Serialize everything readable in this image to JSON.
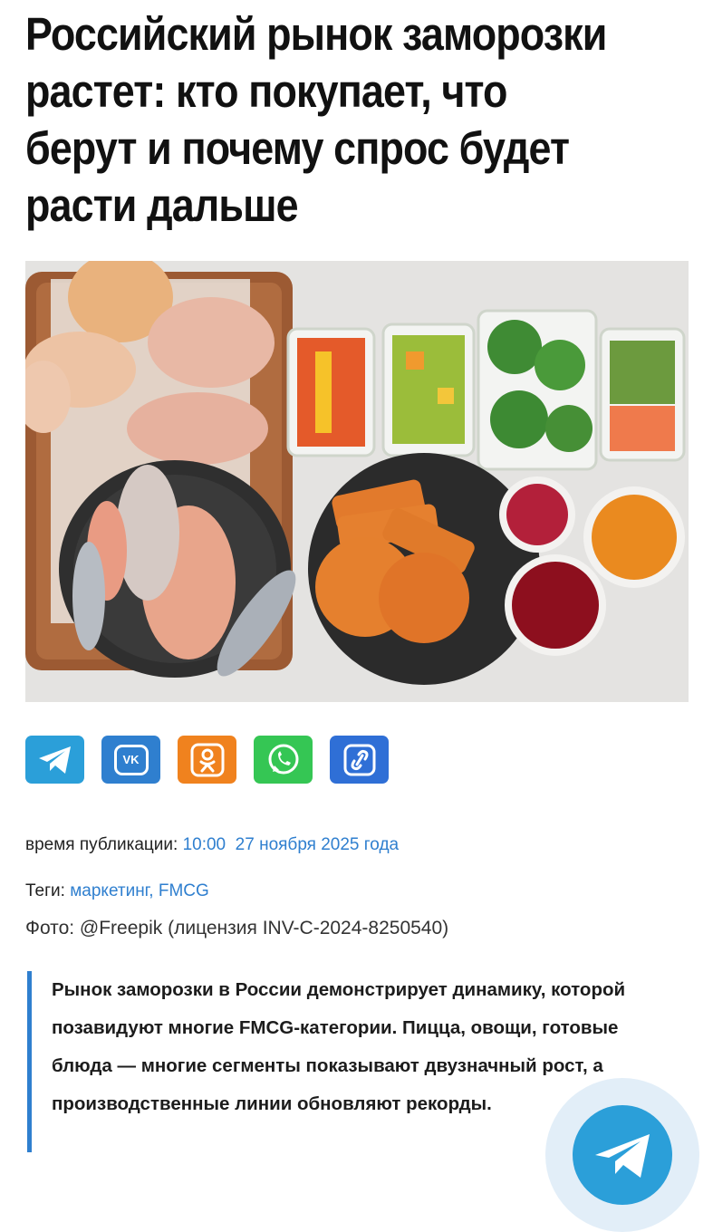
{
  "article": {
    "title": "Российский рынок заморозки растет: кто покупает, что берут и почему спрос будет расти дальше"
  },
  "share": {
    "buttons": [
      {
        "name": "telegram",
        "color": "#2b9fd9",
        "icon": "telegram-icon"
      },
      {
        "name": "vk",
        "color": "#2f7fcf",
        "icon": "vk-icon",
        "label": "VK"
      },
      {
        "name": "odnoklassniki",
        "color": "#f0821e",
        "icon": "ok-icon"
      },
      {
        "name": "whatsapp",
        "color": "#35c654",
        "icon": "whatsapp-icon"
      },
      {
        "name": "copy-link",
        "color": "#2f6fd6",
        "icon": "link-icon"
      }
    ]
  },
  "meta": {
    "published_label": "время публикации:",
    "published_time": "10:00",
    "published_date": "27 ноября 2025 года",
    "tags_label": "Теги:",
    "tags": "маркетинг, FMCG",
    "photo_credit": "Фото: @Freepik (лицензия INV-C-2024-8250540)"
  },
  "lead": "Рынок заморозки в России демонстрирует динамику, которой позавидуют многие FMCG-категории. Пицца, овощи, готовые блюда — многие сегменты показывают двузначный рост, а производственные линии обновляют рекорды.",
  "colors": {
    "link": "#2f7fcf",
    "quote_border": "#2f7fcf",
    "telegram_float": "#2b9fd9"
  }
}
